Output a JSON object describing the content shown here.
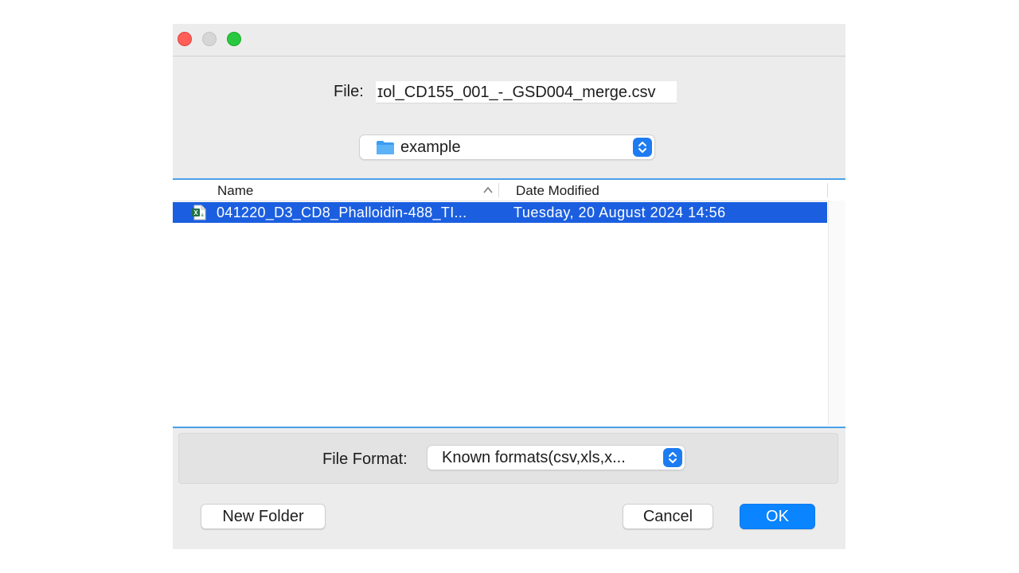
{
  "window": {
    "traffic_lights": [
      "close",
      "minimize",
      "maximize"
    ]
  },
  "file": {
    "label": "File:",
    "value": "ɪol_CD155_001_-_GSD004_merge.csv"
  },
  "location": {
    "folder": "example",
    "icon": "folder-icon"
  },
  "browser": {
    "columns": {
      "name": "Name",
      "date": "Date Modified"
    },
    "sort": "ascending",
    "rows": [
      {
        "name": "041220_D3_CD8_Phalloidin-488_TI...",
        "date": "Tuesday, 20 August 2024 14:56",
        "icon": "excel-file-icon",
        "selected": true
      }
    ]
  },
  "format": {
    "label": "File Format:",
    "value": "Known formats(csv,xls,x..."
  },
  "buttons": {
    "new_folder": "New Folder",
    "cancel": "Cancel",
    "ok": "OK"
  },
  "colors": {
    "selection": "#1b5fe0",
    "accent": "#0a84ff",
    "divider": "#4aa0e8"
  }
}
